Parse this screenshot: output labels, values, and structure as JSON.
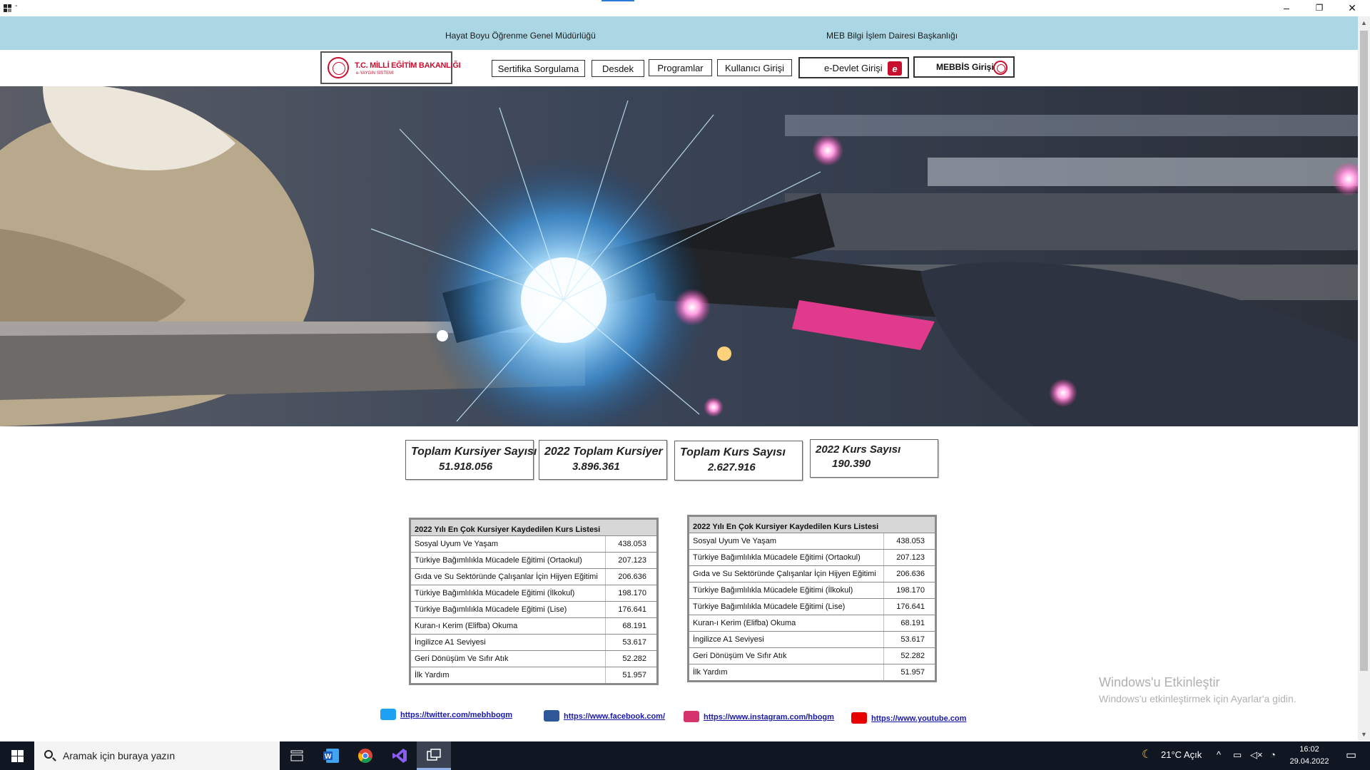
{
  "window": {
    "dash": "-",
    "minimize_glyph": "–",
    "restore_glyph": "❐",
    "close_glyph": "✕"
  },
  "header": {
    "left_text": "Hayat Boyu Öğrenme Genel Müdürlüğü",
    "right_text": "MEB Bilgi İşlem Dairesi Başkanlığı"
  },
  "logo": {
    "title": "T.C. MİLLİ EĞİTİM BAKANLIĞI",
    "subtitle": "e-YAYGIN SİSTEMİ"
  },
  "nav": {
    "sertifika": "Sertifika Sorgulama",
    "desdek": "Desdek",
    "programlar": "Programlar",
    "kullanici": "Kullanıcı Girişi",
    "edevlet": "e-Devlet Girişi",
    "mebbis": "MEBBİS Girişi"
  },
  "stats": [
    {
      "label": "Toplam Kursiyer Sayısı",
      "value": "51.918.056"
    },
    {
      "label": "2022 Toplam Kursiyer",
      "value": "3.896.361"
    },
    {
      "label": "Toplam Kurs Sayısı",
      "value": "2.627.916"
    },
    {
      "label": "2022 Kurs Sayısı",
      "value": "190.390"
    }
  ],
  "table_left": {
    "title": "2022 Yılı En Çok Kursiyer Kaydedilen Kurs Listesi",
    "rows": [
      {
        "name": "Sosyal Uyum Ve Yaşam",
        "value": "438.053"
      },
      {
        "name": "Türkiye Bağımlılıkla Mücadele Eğitimi (Ortaokul)",
        "value": "207.123"
      },
      {
        "name": "Gıda ve Su Sektöründe Çalışanlar İçin Hijyen Eğitimi",
        "value": "206.636"
      },
      {
        "name": "Türkiye Bağımlılıkla Mücadele Eğitimi (İlkokul)",
        "value": "198.170"
      },
      {
        "name": "Türkiye Bağımlılıkla Mücadele Eğitimi (Lise)",
        "value": "176.641"
      },
      {
        "name": "Kuran-ı Kerim (Elifba) Okuma",
        "value": "68.191"
      },
      {
        "name": "İngilizce A1 Seviyesi",
        "value": "53.617"
      },
      {
        "name": "Geri Dönüşüm Ve Sıfır Atık",
        "value": "52.282"
      },
      {
        "name": "İlk Yardım",
        "value": "51.957"
      }
    ]
  },
  "table_right": {
    "title": "2022 Yılı En Çok Kursiyer Kaydedilen Kurs Listesi",
    "rows": [
      {
        "name": "Sosyal Uyum Ve Yaşam",
        "value": "438.053"
      },
      {
        "name": "Türkiye Bağımlılıkla Mücadele Eğitimi (Ortaokul)",
        "value": "207.123"
      },
      {
        "name": "Gıda ve Su Sektöründe Çalışanlar İçin Hijyen Eğitimi",
        "value": "206.636"
      },
      {
        "name": "Türkiye Bağımlılıkla Mücadele Eğitimi (İlkokul)",
        "value": "198.170"
      },
      {
        "name": "Türkiye Bağımlılıkla Mücadele Eğitimi (Lise)",
        "value": "176.641"
      },
      {
        "name": "Kuran-ı Kerim (Elifba) Okuma",
        "value": "68.191"
      },
      {
        "name": "İngilizce A1 Seviyesi",
        "value": "53.617"
      },
      {
        "name": "Geri Dönüşüm Ve Sıfır Atık",
        "value": "52.282"
      },
      {
        "name": "İlk Yardım",
        "value": "51.957"
      }
    ]
  },
  "social": {
    "twitter": "https://twitter.com/mebhbogm",
    "facebook": "https://www.facebook.com/",
    "instagram": "https://www.instagram.com/hbogm",
    "youtube": "https://www.youtube.com"
  },
  "watermark": {
    "title": "Windows'u Etkinleştir",
    "subtitle": "Windows'u etkinleştirmek için Ayarlar'a gidin."
  },
  "taskbar": {
    "search_placeholder": "Aramak için buraya yazın",
    "weather": "21°C  Açık",
    "time": "16:02",
    "date": "29.04.2022"
  },
  "colors": {
    "header_band": "#abd7e5",
    "brand_red": "#c8102e",
    "link_blue": "#1a1aaa",
    "taskbar": "#101622"
  },
  "icons": [
    "app-icon",
    "edevlet-icon",
    "mebbis-seal-icon",
    "twitter-icon",
    "facebook-icon",
    "instagram-icon",
    "youtube-icon",
    "windows-start-icon",
    "search-icon",
    "task-view-icon",
    "word-icon",
    "chrome-icon",
    "visual-studio-icon",
    "remote-desktop-icon",
    "moon-icon",
    "chevron-up-icon",
    "network-icon",
    "speaker-muted-icon",
    "wifi-icon",
    "notification-icon"
  ]
}
